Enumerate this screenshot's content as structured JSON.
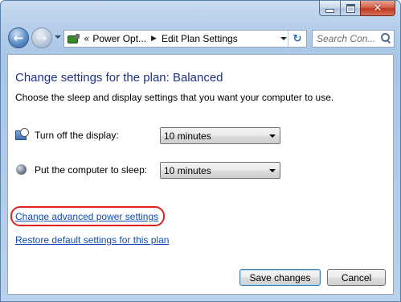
{
  "window": {
    "caption_buttons": [
      "minimize-icon",
      "maximize-icon",
      "close-icon"
    ]
  },
  "nav": {
    "back_icon": "back-arrow-icon",
    "forward_icon": "forward-arrow-icon"
  },
  "address": {
    "overflow_chevron": "«",
    "crumbs": [
      "Power Opt...",
      "Edit Plan Settings"
    ],
    "separator": "▶",
    "refresh_icon": "refresh-icon"
  },
  "search": {
    "placeholder": "Search Con..."
  },
  "main": {
    "heading": "Change settings for the plan: Balanced",
    "subtext": "Choose the sleep and display settings that you want your computer to use.",
    "settings": [
      {
        "label": "Turn off the display:",
        "value": "10 minutes",
        "icon": "display-timer-icon"
      },
      {
        "label": "Put the computer to sleep:",
        "value": "10 minutes",
        "icon": "sleep-moon-icon"
      }
    ],
    "links": {
      "advanced": "Change advanced power settings",
      "restore": "Restore default settings for this plan"
    },
    "highlight_color": "#e02020"
  },
  "buttons": {
    "save": "Save changes",
    "cancel": "Cancel"
  },
  "colors": {
    "heading": "#1e3287",
    "link": "#0e4bb5",
    "frame": "#b7cfea"
  }
}
